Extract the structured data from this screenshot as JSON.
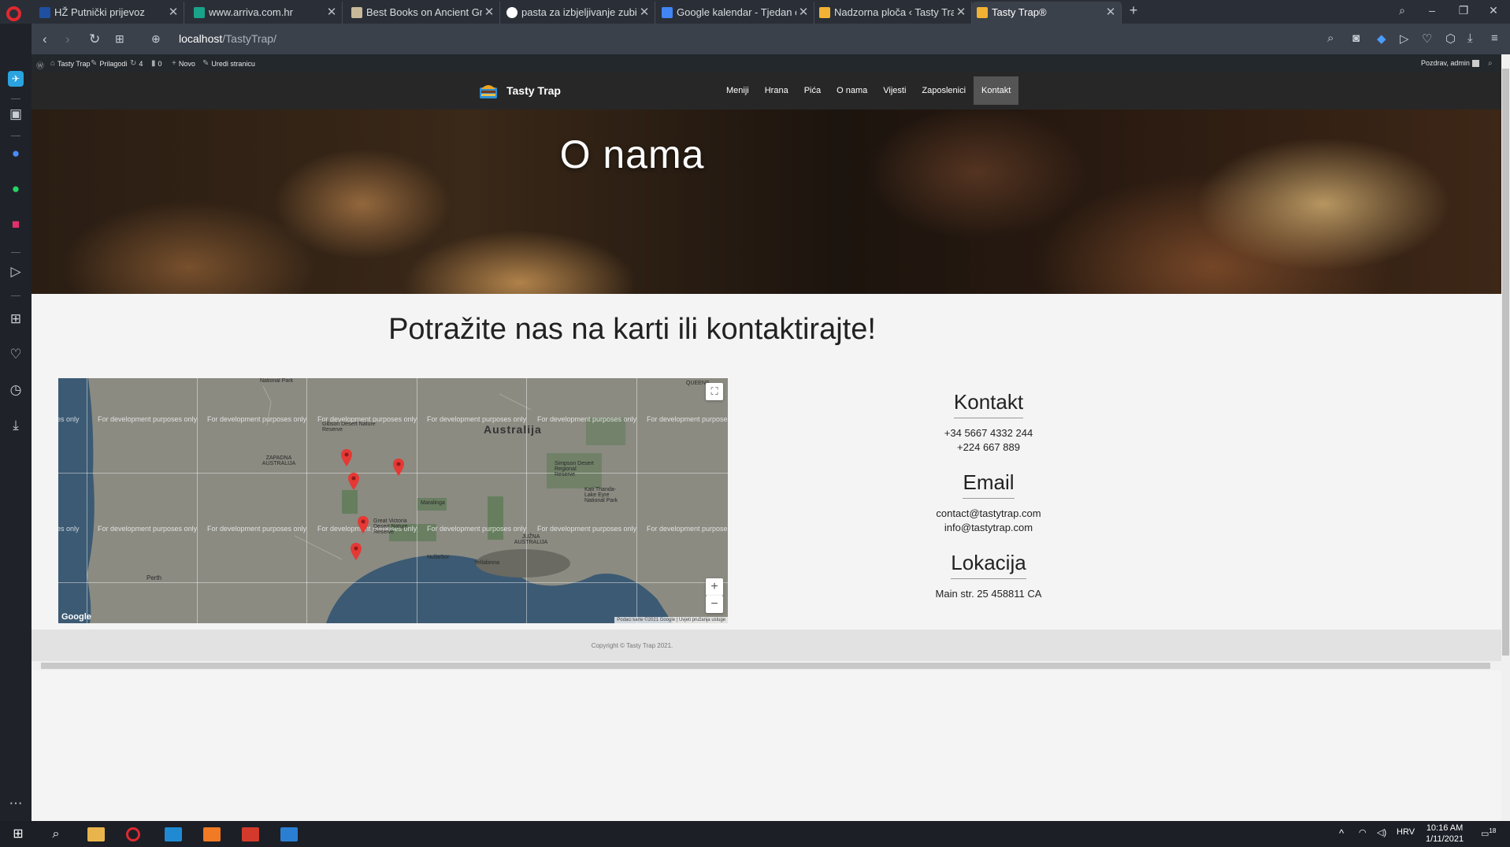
{
  "browser": {
    "tabs": [
      {
        "title": "HŽ Putnički prijevoz",
        "active": false,
        "color": "#1f4fa0"
      },
      {
        "title": "www.arriva.com.hr",
        "active": false,
        "color": "#19a38a"
      },
      {
        "title": "Best Books on Ancient Gre",
        "active": false,
        "color": "#c8b99a"
      },
      {
        "title": "pasta za izbjeljivanje zubi -",
        "active": false,
        "color": "#ffffff"
      },
      {
        "title": "Google kalendar - Tjedan o",
        "active": false,
        "color": "#4285f4"
      },
      {
        "title": "Nadzorna ploča ‹ Tasty Trap",
        "active": false,
        "color": "#f2b233"
      },
      {
        "title": "Tasty Trap®",
        "active": true,
        "color": "#f2b233"
      }
    ],
    "new_tab_label": "+",
    "url_host": "localhost",
    "url_path": "/TastyTrap/"
  },
  "wp_admin_bar": {
    "site_name": "Tasty Trap",
    "customize": "Prilagodi",
    "updates_count": "4",
    "comments_count": "0",
    "new_label": "Novo",
    "edit_label": "Uredi stranicu",
    "greeting": "Pozdrav, admin"
  },
  "site": {
    "logo_text": "Tasty Trap",
    "menu": [
      {
        "label": "Meniji",
        "active": false
      },
      {
        "label": "Hrana",
        "active": false
      },
      {
        "label": "Pića",
        "active": false
      },
      {
        "label": "O nama",
        "active": false
      },
      {
        "label": "Vijesti",
        "active": false
      },
      {
        "label": "Zaposlenici",
        "active": false
      },
      {
        "label": "Kontakt",
        "active": true
      }
    ],
    "hero_title": "O nama",
    "section_title": "Potražite nas na karti ili kontaktirajte!",
    "map": {
      "country_label": "Australija",
      "dev_watermark": "For development purposes only",
      "attribution": "Podaci karte ©2021 Google | Uvjeti pružanja usluge",
      "google": "Google",
      "zoom_in": "+",
      "zoom_out": "−",
      "places": [
        "National Park",
        "Gibson Desert Nature Reserve",
        "ZAPADNA AUSTRALIJA",
        "Great Victoria Desert Nature Reserve",
        "Simpson Desert Regional Reserve",
        "Kati Thanda-Lake Eyre National Park",
        "JUŽNA AUSTRALIJA",
        "Nullarbor",
        "Yellabinna",
        "Perth",
        "Maralinga",
        "QUEENS"
      ]
    },
    "contact": {
      "heading": "Kontakt",
      "phones": [
        "+34 5667 4332 244",
        "+224 667 889"
      ]
    },
    "email": {
      "heading": "Email",
      "addresses": [
        "contact@tastytrap.com",
        "info@tastytrap.com"
      ]
    },
    "location": {
      "heading": "Lokacija",
      "address": "Main str. 25 458811 CA"
    },
    "footer": "Copyright © Tasty Trap 2021."
  },
  "taskbar": {
    "language": "HRV",
    "time": "10:16 AM",
    "date": "1/11/2021",
    "notifications": "18"
  }
}
